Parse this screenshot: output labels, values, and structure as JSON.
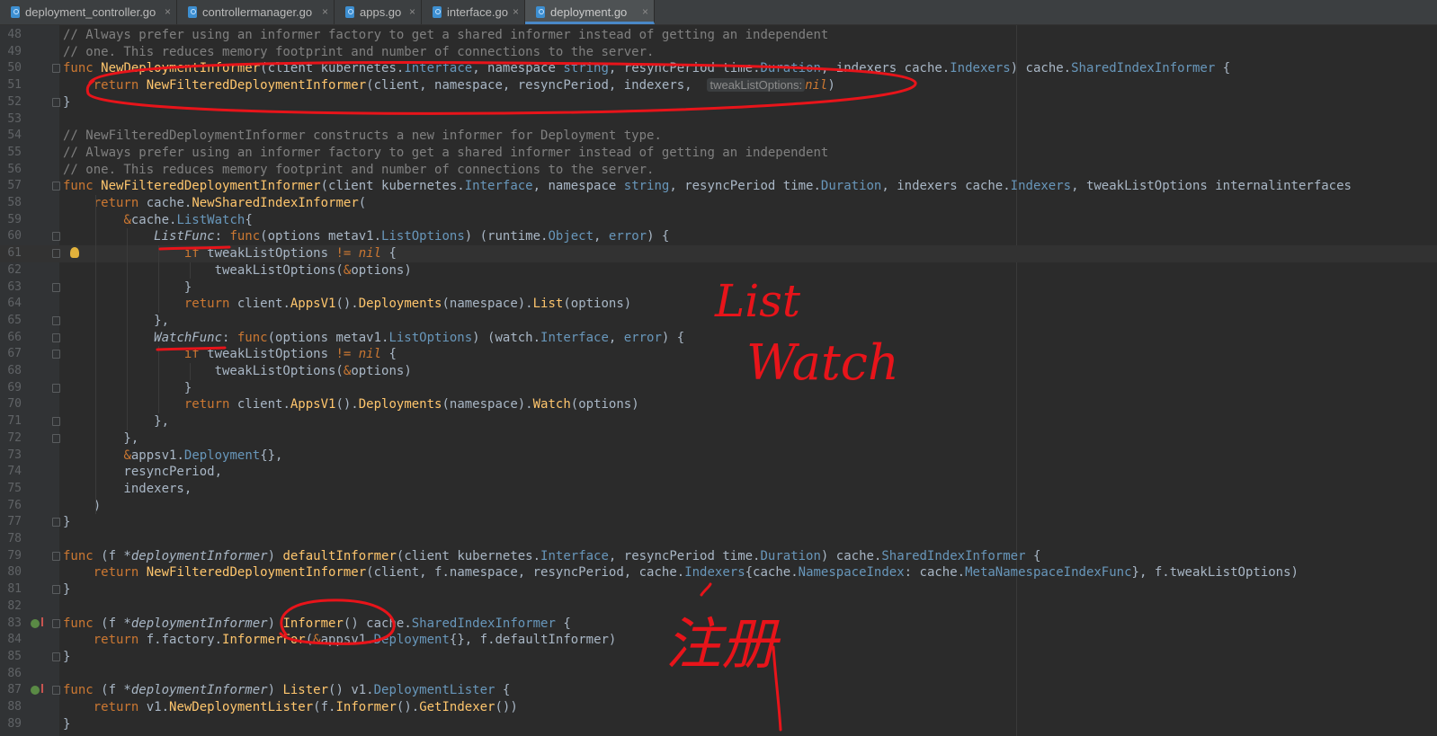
{
  "tabs": [
    {
      "label": "deployment_controller.go",
      "active": false
    },
    {
      "label": "controllermanager.go",
      "active": false
    },
    {
      "label": "apps.go",
      "active": false
    },
    {
      "label": "interface.go",
      "active": false
    },
    {
      "label": "deployment.go",
      "active": true
    }
  ],
  "tab_close_glyph": "×",
  "editor": {
    "current_line": 61,
    "lines": [
      {
        "n": 48,
        "t": "// Always prefer using an informer factory to get a shared informer instead of getting an independent"
      },
      {
        "n": 49,
        "t": "// one. This reduces memory footprint and number of connections to the server."
      },
      {
        "n": 50,
        "t": "func NewDeploymentInformer(client kubernetes.Interface, namespace string, resyncPeriod time.Duration, indexers cache.Indexers) cache.SharedIndexInformer {"
      },
      {
        "n": 51,
        "t": "    return NewFilteredDeploymentInformer(client, namespace, resyncPeriod, indexers,  tweakListOptions: nil)"
      },
      {
        "n": 52,
        "t": "}"
      },
      {
        "n": 53,
        "t": ""
      },
      {
        "n": 54,
        "t": "// NewFilteredDeploymentInformer constructs a new informer for Deployment type."
      },
      {
        "n": 55,
        "t": "// Always prefer using an informer factory to get a shared informer instead of getting an independent"
      },
      {
        "n": 56,
        "t": "// one. This reduces memory footprint and number of connections to the server."
      },
      {
        "n": 57,
        "t": "func NewFilteredDeploymentInformer(client kubernetes.Interface, namespace string, resyncPeriod time.Duration, indexers cache.Indexers, tweakListOptions internalinterfaces"
      },
      {
        "n": 58,
        "t": "    return cache.NewSharedIndexInformer("
      },
      {
        "n": 59,
        "t": "        &cache.ListWatch{"
      },
      {
        "n": 60,
        "t": "            ListFunc: func(options metav1.ListOptions) (runtime.Object, error) {"
      },
      {
        "n": 61,
        "t": "                if tweakListOptions != nil {"
      },
      {
        "n": 62,
        "t": "                    tweakListOptions(&options)"
      },
      {
        "n": 63,
        "t": "                }"
      },
      {
        "n": 64,
        "t": "                return client.AppsV1().Deployments(namespace).List(options)"
      },
      {
        "n": 65,
        "t": "            },"
      },
      {
        "n": 66,
        "t": "            WatchFunc: func(options metav1.ListOptions) (watch.Interface, error) {"
      },
      {
        "n": 67,
        "t": "                if tweakListOptions != nil {"
      },
      {
        "n": 68,
        "t": "                    tweakListOptions(&options)"
      },
      {
        "n": 69,
        "t": "                }"
      },
      {
        "n": 70,
        "t": "                return client.AppsV1().Deployments(namespace).Watch(options)"
      },
      {
        "n": 71,
        "t": "            },"
      },
      {
        "n": 72,
        "t": "        },"
      },
      {
        "n": 73,
        "t": "        &appsv1.Deployment{},"
      },
      {
        "n": 74,
        "t": "        resyncPeriod,"
      },
      {
        "n": 75,
        "t": "        indexers,"
      },
      {
        "n": 76,
        "t": "    )"
      },
      {
        "n": 77,
        "t": "}"
      },
      {
        "n": 78,
        "t": ""
      },
      {
        "n": 79,
        "t": "func (f *deploymentInformer) defaultInformer(client kubernetes.Interface, resyncPeriod time.Duration) cache.SharedIndexInformer {"
      },
      {
        "n": 80,
        "t": "    return NewFilteredDeploymentInformer(client, f.namespace, resyncPeriod, cache.Indexers{cache.NamespaceIndex: cache.MetaNamespaceIndexFunc}, f.tweakListOptions)"
      },
      {
        "n": 81,
        "t": "}"
      },
      {
        "n": 82,
        "t": ""
      },
      {
        "n": 83,
        "t": "func (f *deploymentInformer) Informer() cache.SharedIndexInformer {"
      },
      {
        "n": 84,
        "t": "    return f.factory.InformerFor(&appsv1.Deployment{}, f.defaultInformer)"
      },
      {
        "n": 85,
        "t": "}"
      },
      {
        "n": 86,
        "t": ""
      },
      {
        "n": 87,
        "t": "func (f *deploymentInformer) Lister() v1.DeploymentLister {"
      },
      {
        "n": 88,
        "t": "    return v1.NewDeploymentLister(f.Informer().GetIndexer())"
      },
      {
        "n": 89,
        "t": "}"
      }
    ]
  },
  "annotations": {
    "list_label": "List",
    "watch_label": "Watch",
    "register_label": "注册",
    "ink_color": "#e8141a"
  },
  "colors": {
    "keyword": "#cc7832",
    "comment": "#808080",
    "function": "#ffc66d",
    "type": "#6897bb",
    "text": "#a9b7c6",
    "background": "#2b2b2b"
  }
}
